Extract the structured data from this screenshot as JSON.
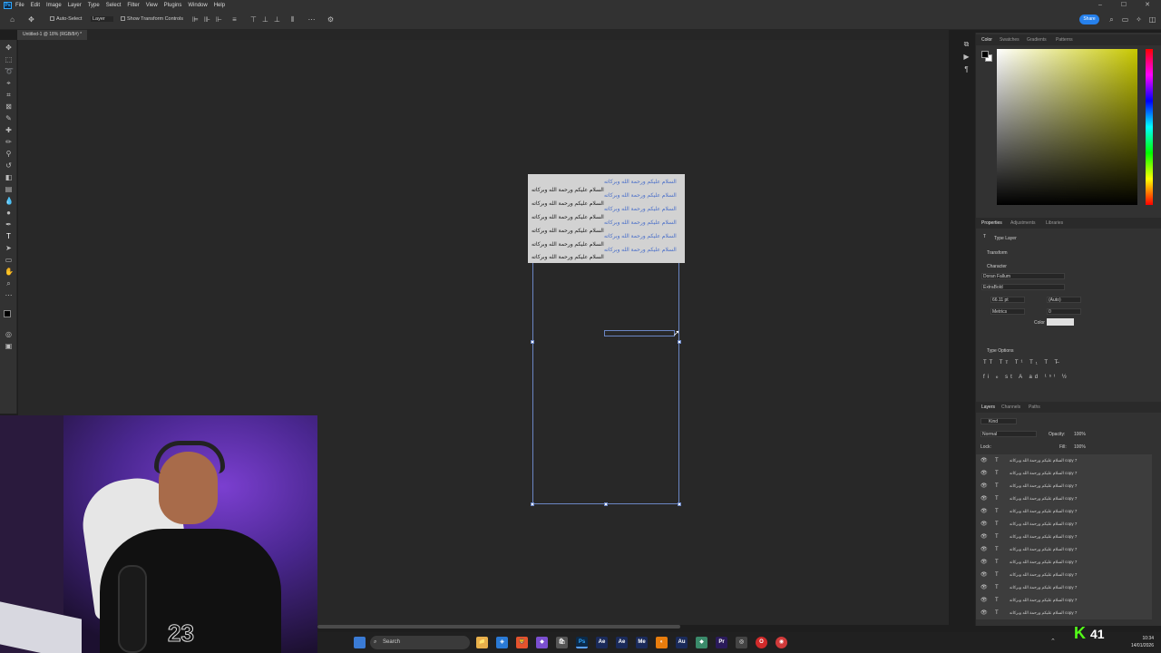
{
  "app": {
    "logo": "Ps"
  },
  "menu": [
    "File",
    "Edit",
    "Image",
    "Layer",
    "Type",
    "Select",
    "Filter",
    "View",
    "Plugins",
    "Window",
    "Help"
  ],
  "window_controls": {
    "minimize": "–",
    "maximize": "☐",
    "close": "✕"
  },
  "options_bar": {
    "auto_select_label": "Auto-Select",
    "auto_select_target": "Layer",
    "transform_label": "Show Transform Controls",
    "share_label": "Share"
  },
  "document": {
    "tab_title": "Untitled-1 @ 18% (RGB/8#) *"
  },
  "canvas": {
    "text_lines": [
      "السلام عليكم ورحمة الله وبركاته",
      "السلام عليكم ورحمة الله وبركاته",
      "السلام عليكم ورحمة الله وبركاته",
      "السلام عليكم ورحمة الله وبركاته",
      "السلام عليكم ورحمة الله وبركاته",
      "السلام عليكم ورحمة الله وبركاته",
      "السلام عليكم ورحمة الله وبركاته"
    ],
    "selected_color": "#4a6fc9",
    "text_color": "#1a1a1a"
  },
  "color_panel": {
    "tabs": [
      "Color",
      "Swatches",
      "Gradients",
      "Patterns"
    ],
    "foreground": "#000000",
    "background": "#ffffff",
    "hue_color": "#c8c800"
  },
  "properties_panel": {
    "tabs": [
      "Properties",
      "Adjustments",
      "Libraries"
    ],
    "layer_kind": "Type Layer",
    "transform_label": "Transform",
    "character_label": "Character",
    "font_family": "Doran Fallum",
    "font_style": "ExtraBold",
    "font_size": "66.11 pt",
    "leading": "(Auto)",
    "kerning": "Metrics",
    "tracking": "0",
    "color_label": "Color",
    "type_options_label": "Type Options"
  },
  "layers_panel": {
    "tabs": [
      "Layers",
      "Channels",
      "Paths"
    ],
    "filter": "Kind",
    "blend_mode": "Normal",
    "opacity_label": "Opacity:",
    "opacity": "100%",
    "lock_label": "Lock:",
    "fill_label": "Fill:",
    "fill": "100%",
    "layers": [
      "السلام عليكم ورحمة الله وبركاته copy 7",
      "السلام عليكم ورحمة الله وبركاته copy 7",
      "السلام عليكم ورحمة الله وبركاته copy 7",
      "السلام عليكم ورحمة الله وبركاته copy 7",
      "السلام عليكم ورحمة الله وبركاته copy 7",
      "السلام عليكم ورحمة الله وبركاته copy 7",
      "السلام عليكم ورحمة الله وبركاته copy 7",
      "السلام عليكم ورحمة الله وبركاته copy 7",
      "السلام عليكم ورحمة الله وبركاته copy 7",
      "السلام عليكم ورحمة الله وبركاته copy 7",
      "السلام عليكم ورحمة الله وبركاته copy 7",
      "السلام عليكم ورحمة الله وبركاته copy 7",
      "السلام عليكم ورحمة الله وبركاته copy 7"
    ]
  },
  "webcam": {
    "jersey_number": "23"
  },
  "taskbar": {
    "search_label": "Search",
    "apps": [
      "Explorer",
      "VS Code",
      "Brave",
      "Visual Studio",
      "Store",
      "Photoshop",
      "Ae",
      "Ae",
      "Me",
      "Blender",
      "Au",
      "App",
      "Pr",
      "App",
      "Opera",
      "Chrome"
    ],
    "app_labels": [
      "📁",
      "◈",
      "🦁",
      "◆",
      "🛍",
      "Ps",
      "Ae",
      "Ae",
      "Me",
      "◐",
      "Au",
      "◆",
      "Pr",
      "◎",
      "O",
      "◉"
    ],
    "time": "10:34",
    "date": "14/01/2026"
  },
  "overlay": {
    "kick_count": "41"
  }
}
